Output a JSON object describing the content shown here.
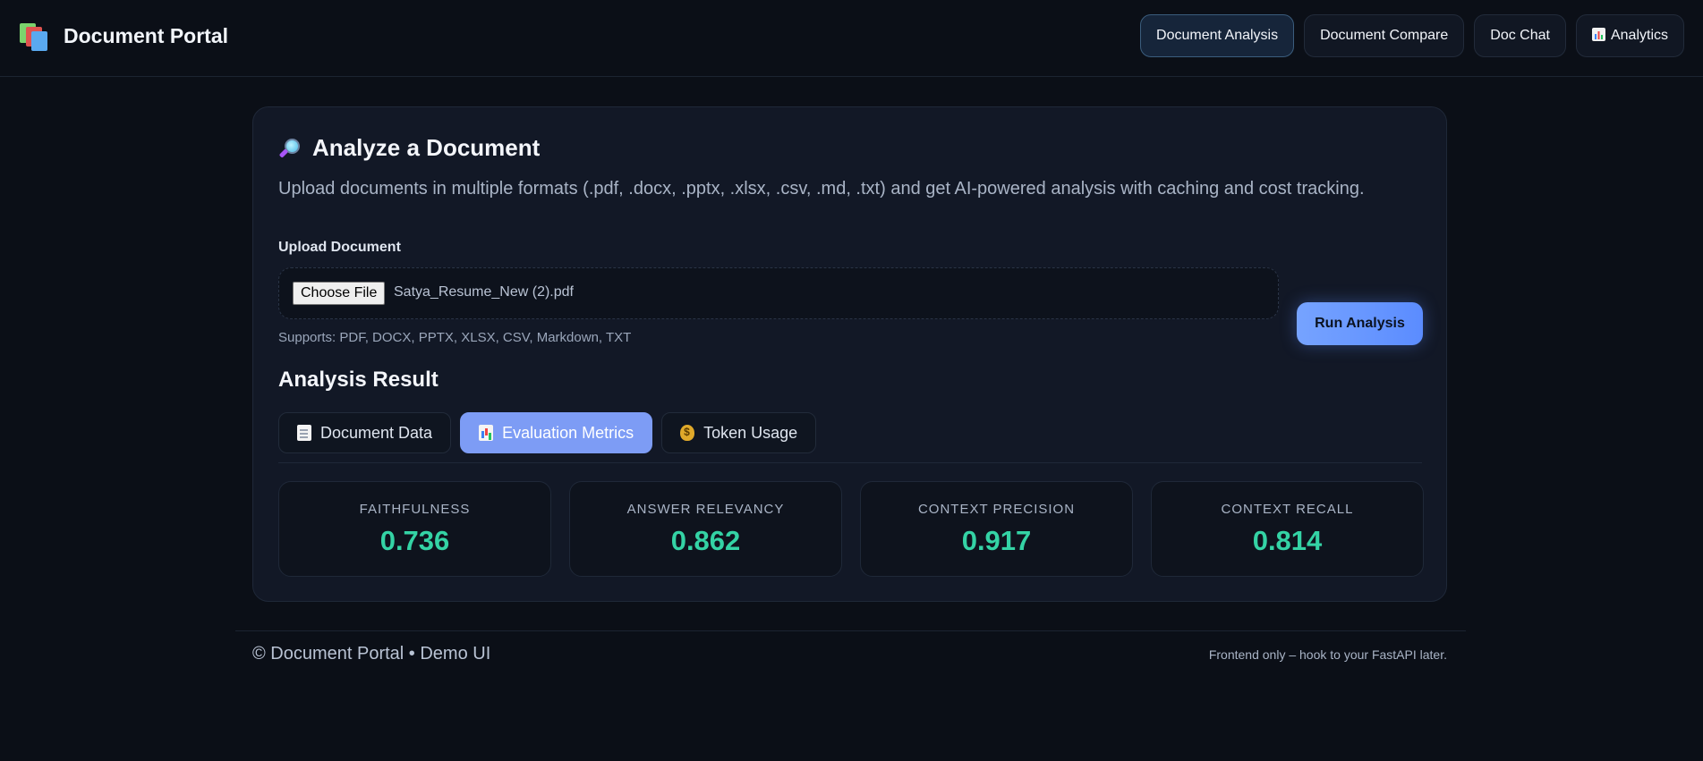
{
  "header": {
    "title": "Document Portal",
    "logo_icon": "books-icon",
    "nav": [
      {
        "label": "Document Analysis",
        "active": true
      },
      {
        "label": "Document Compare",
        "active": false
      },
      {
        "label": "Doc Chat",
        "active": false
      },
      {
        "label": "Analytics",
        "active": false,
        "icon": "bar-chart-icon"
      }
    ]
  },
  "main": {
    "title": "Analyze a Document",
    "title_icon": "magnifier-icon",
    "description": "Upload documents in multiple formats (.pdf, .docx, .pptx, .xlsx, .csv, .md, .txt) and get AI-powered analysis with caching and cost tracking.",
    "upload": {
      "label": "Upload Document",
      "button_label": "Choose File",
      "file_name": "Satya_Resume_New (2).pdf",
      "supports": "Supports: PDF, DOCX, PPTX, XLSX, CSV, Markdown, TXT"
    },
    "run_button": "Run Analysis",
    "result_title": "Analysis Result",
    "tabs": [
      {
        "label": "Document Data",
        "icon": "document-icon",
        "active": false
      },
      {
        "label": "Evaluation Metrics",
        "icon": "bar-chart-icon",
        "active": true
      },
      {
        "label": "Token Usage",
        "icon": "money-bag-icon",
        "active": false
      }
    ],
    "metrics": [
      {
        "label": "FAITHFULNESS",
        "value": "0.736"
      },
      {
        "label": "ANSWER RELEVANCY",
        "value": "0.862"
      },
      {
        "label": "CONTEXT PRECISION",
        "value": "0.917"
      },
      {
        "label": "CONTEXT RECALL",
        "value": "0.814"
      }
    ]
  },
  "footer": {
    "left": "© Document Portal • Demo UI",
    "right": "Frontend only – hook to your FastAPI later."
  },
  "colors": {
    "background": "#0b0f17",
    "card": "#121826",
    "accent": "#7d9cf5",
    "metric_value": "#34d3a5"
  }
}
